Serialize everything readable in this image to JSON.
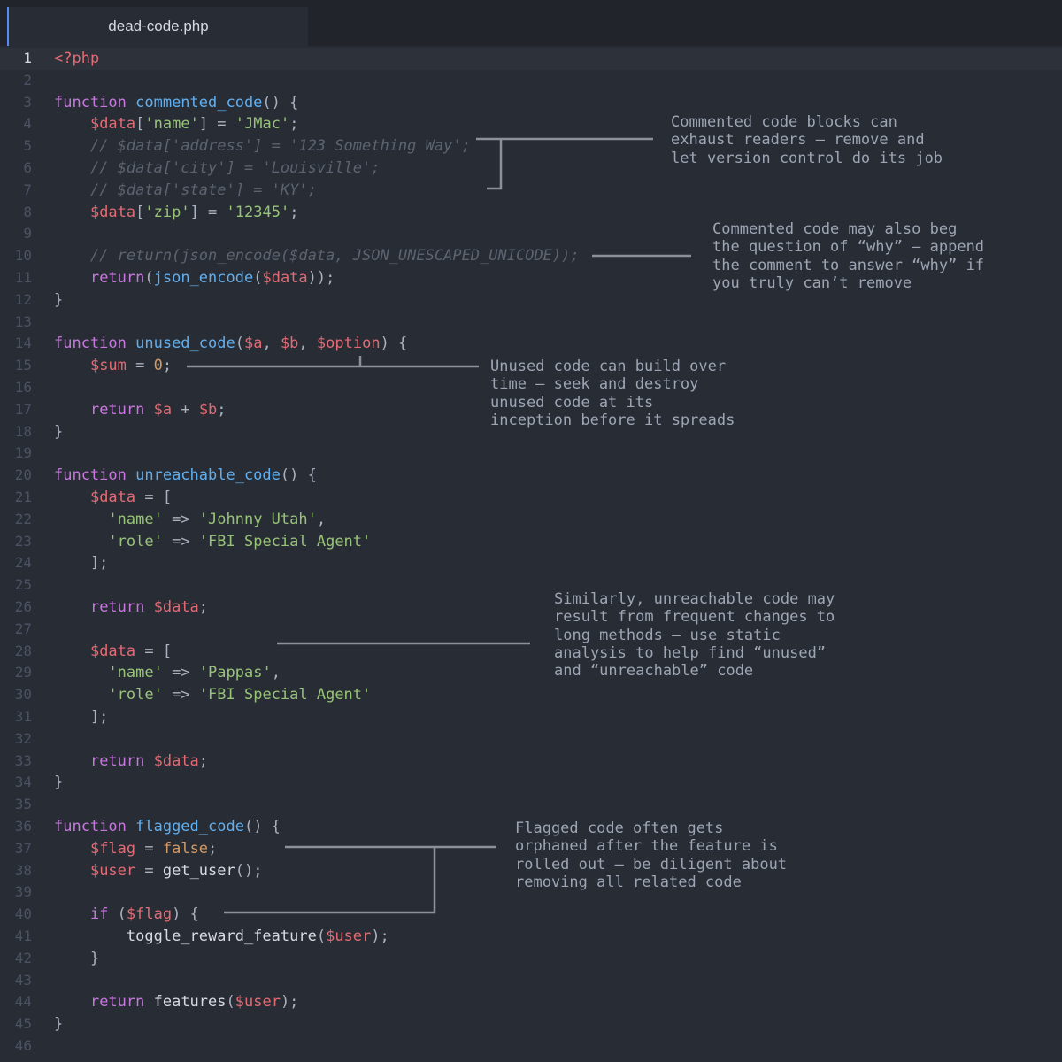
{
  "tab": {
    "title": "dead-code.php"
  },
  "current_line": 1,
  "lines": [
    [
      [
        "t",
        "<?php"
      ]
    ],
    [],
    [
      [
        "k",
        "function "
      ],
      [
        "f",
        "commented_code"
      ],
      [
        "p",
        "() {"
      ]
    ],
    [
      [
        "p",
        "    "
      ],
      [
        "v",
        "$data"
      ],
      [
        "p",
        "["
      ],
      [
        "s",
        "'name'"
      ],
      [
        "p",
        "] = "
      ],
      [
        "s",
        "'JMac'"
      ],
      [
        "p",
        ";"
      ]
    ],
    [
      [
        "c",
        "    // $data['address'] = '123 Something Way';"
      ]
    ],
    [
      [
        "c",
        "    // $data['city'] = 'Louisville';"
      ]
    ],
    [
      [
        "c",
        "    // $data['state'] = 'KY';"
      ]
    ],
    [
      [
        "p",
        "    "
      ],
      [
        "v",
        "$data"
      ],
      [
        "p",
        "["
      ],
      [
        "s",
        "'zip'"
      ],
      [
        "p",
        "] = "
      ],
      [
        "s",
        "'12345'"
      ],
      [
        "p",
        ";"
      ]
    ],
    [],
    [
      [
        "c",
        "    // return(json_encode($data, JSON_UNESCAPED_UNICODE));"
      ]
    ],
    [
      [
        "p",
        "    "
      ],
      [
        "k",
        "return"
      ],
      [
        "p",
        "("
      ],
      [
        "f",
        "json_encode"
      ],
      [
        "p",
        "("
      ],
      [
        "v",
        "$data"
      ],
      [
        "p",
        "));"
      ]
    ],
    [
      [
        "p",
        "}"
      ]
    ],
    [],
    [
      [
        "k",
        "function "
      ],
      [
        "f",
        "unused_code"
      ],
      [
        "p",
        "("
      ],
      [
        "v",
        "$a"
      ],
      [
        "p",
        ", "
      ],
      [
        "v",
        "$b"
      ],
      [
        "p",
        ", "
      ],
      [
        "v",
        "$option"
      ],
      [
        "p",
        ") {"
      ]
    ],
    [
      [
        "p",
        "    "
      ],
      [
        "v",
        "$sum"
      ],
      [
        "p",
        " = "
      ],
      [
        "n",
        "0"
      ],
      [
        "p",
        ";"
      ]
    ],
    [],
    [
      [
        "p",
        "    "
      ],
      [
        "k",
        "return "
      ],
      [
        "v",
        "$a"
      ],
      [
        "p",
        " + "
      ],
      [
        "v",
        "$b"
      ],
      [
        "p",
        ";"
      ]
    ],
    [
      [
        "p",
        "}"
      ]
    ],
    [],
    [
      [
        "k",
        "function "
      ],
      [
        "f",
        "unreachable_code"
      ],
      [
        "p",
        "() {"
      ]
    ],
    [
      [
        "p",
        "    "
      ],
      [
        "v",
        "$data"
      ],
      [
        "p",
        " = ["
      ]
    ],
    [
      [
        "p",
        "      "
      ],
      [
        "s",
        "'name'"
      ],
      [
        "p",
        " => "
      ],
      [
        "s",
        "'Johnny Utah'"
      ],
      [
        "p",
        ","
      ]
    ],
    [
      [
        "p",
        "      "
      ],
      [
        "s",
        "'role'"
      ],
      [
        "p",
        " => "
      ],
      [
        "s",
        "'FBI Special Agent'"
      ]
    ],
    [
      [
        "p",
        "    ];"
      ]
    ],
    [],
    [
      [
        "p",
        "    "
      ],
      [
        "k",
        "return "
      ],
      [
        "v",
        "$data"
      ],
      [
        "p",
        ";"
      ]
    ],
    [],
    [
      [
        "p",
        "    "
      ],
      [
        "v",
        "$data"
      ],
      [
        "p",
        " = ["
      ]
    ],
    [
      [
        "p",
        "      "
      ],
      [
        "s",
        "'name'"
      ],
      [
        "p",
        " => "
      ],
      [
        "s",
        "'Pappas'"
      ],
      [
        "p",
        ","
      ]
    ],
    [
      [
        "p",
        "      "
      ],
      [
        "s",
        "'role'"
      ],
      [
        "p",
        " => "
      ],
      [
        "s",
        "'FBI Special Agent'"
      ]
    ],
    [
      [
        "p",
        "    ];"
      ]
    ],
    [],
    [
      [
        "p",
        "    "
      ],
      [
        "k",
        "return "
      ],
      [
        "v",
        "$data"
      ],
      [
        "p",
        ";"
      ]
    ],
    [
      [
        "p",
        "}"
      ]
    ],
    [],
    [
      [
        "k",
        "function "
      ],
      [
        "f",
        "flagged_code"
      ],
      [
        "p",
        "() {"
      ]
    ],
    [
      [
        "p",
        "    "
      ],
      [
        "v",
        "$flag"
      ],
      [
        "p",
        " = "
      ],
      [
        "n",
        "false"
      ],
      [
        "p",
        ";"
      ]
    ],
    [
      [
        "p",
        "    "
      ],
      [
        "v",
        "$user"
      ],
      [
        "p",
        " = "
      ],
      [
        "plain",
        "get_user"
      ],
      [
        "p",
        "();"
      ]
    ],
    [],
    [
      [
        "p",
        "    "
      ],
      [
        "k",
        "if "
      ],
      [
        "p",
        "("
      ],
      [
        "v",
        "$flag"
      ],
      [
        "p",
        ") {"
      ]
    ],
    [
      [
        "p",
        "        "
      ],
      [
        "plain",
        "toggle_reward_feature"
      ],
      [
        "p",
        "("
      ],
      [
        "v",
        "$user"
      ],
      [
        "p",
        ");"
      ]
    ],
    [
      [
        "p",
        "    }"
      ]
    ],
    [],
    [
      [
        "p",
        "    "
      ],
      [
        "k",
        "return "
      ],
      [
        "plain",
        "features"
      ],
      [
        "p",
        "("
      ],
      [
        "v",
        "$user"
      ],
      [
        "p",
        ");"
      ]
    ],
    [
      [
        "p",
        "}"
      ]
    ],
    []
  ],
  "annotations": [
    {
      "text": "Commented code blocks can\nexhaust readers – remove and\nlet version control do its job"
    },
    {
      "text": "Commented code may also beg\nthe question of “why” – append\nthe comment to answer “why” if\nyou truly can’t remove"
    },
    {
      "text": "Unused code can build over\ntime – seek and destroy\nunused code at its\ninception before it spreads"
    },
    {
      "text": "Similarly, unreachable code may\nresult from frequent changes to\nlong methods – use static\nanalysis to help find “unused”\nand “unreachable” code"
    },
    {
      "text": "Flagged code often gets\norphaned after the feature is\nrolled out – be diligent about\nremoving all related code"
    }
  ],
  "colors": {
    "background": "#282c34",
    "keyword": "#c678dd",
    "function": "#61afef",
    "variable": "#e06c75",
    "string": "#98c379",
    "number": "#d19a66",
    "comment": "#5c6370",
    "annotation": "#9da5b4"
  }
}
